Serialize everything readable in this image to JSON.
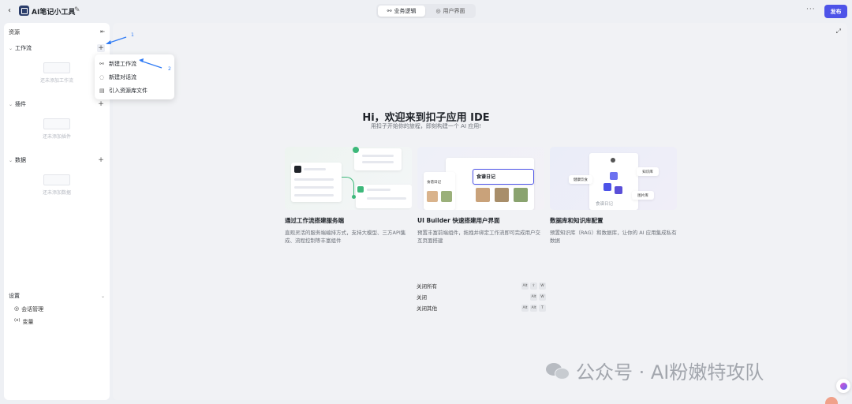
{
  "header": {
    "back_icon": "‹",
    "app_title": "AI笔记小工具",
    "tabs": [
      {
        "label": "业务逻辑",
        "active": true
      },
      {
        "label": "用户界面",
        "active": false
      }
    ],
    "more": "···",
    "publish_label": "发布"
  },
  "sidebar": {
    "resources_label": "资源",
    "sections": [
      {
        "label": "工作流",
        "empty_text": "还未添加工作流"
      },
      {
        "label": "插件",
        "empty_text": "还未添加插件"
      },
      {
        "label": "数据",
        "empty_text": "还未添加数据"
      }
    ],
    "settings": {
      "label": "设置",
      "items": [
        {
          "icon": "◎",
          "label": "会话管理"
        },
        {
          "icon": "(x)",
          "label": "变量"
        }
      ]
    }
  },
  "dropdown": {
    "items": [
      {
        "label": "新建工作流"
      },
      {
        "label": "新建对话流"
      },
      {
        "label": "引入资源库文件"
      }
    ]
  },
  "annotations": {
    "step1": "1",
    "step2": "2"
  },
  "main": {
    "title": "Hi，欢迎来到扣子应用 IDE",
    "subtitle": "用扣子开始你的旅程，即刻构建一个 AI 应用!",
    "cards": [
      {
        "title": "通过工作流搭建服务端",
        "desc": "直观灵活的服务端编排方式，支持大模型、三方API集成、流程控制等丰富组件"
      },
      {
        "title": "UI Builder 快速搭建用户界面",
        "desc": "预置丰富前端组件，拖拽并绑定工作流即可完成用户交互页面搭建",
        "art_label": "食谱日记"
      },
      {
        "title": "数据库和知识库配置",
        "desc": "预置知识库（RAG）和数据库，让你的 AI 应用集成私有数据",
        "art_label": "食谱日记",
        "tags": [
          "健康饮食",
          "知识库",
          "图片库"
        ]
      }
    ],
    "shortcuts": [
      {
        "label": "关闭所有",
        "keys": [
          "Alt",
          "⇧",
          "W"
        ]
      },
      {
        "label": "关闭",
        "keys": [
          "Alt",
          "W"
        ]
      },
      {
        "label": "关闭其他",
        "keys": [
          "Alt",
          "Alt",
          "T"
        ]
      }
    ]
  },
  "watermark": {
    "text": "公众号 · AI粉嫩特攻队"
  },
  "colors": {
    "accent": "#4d53e8",
    "annotation": "#2f7bf5"
  }
}
